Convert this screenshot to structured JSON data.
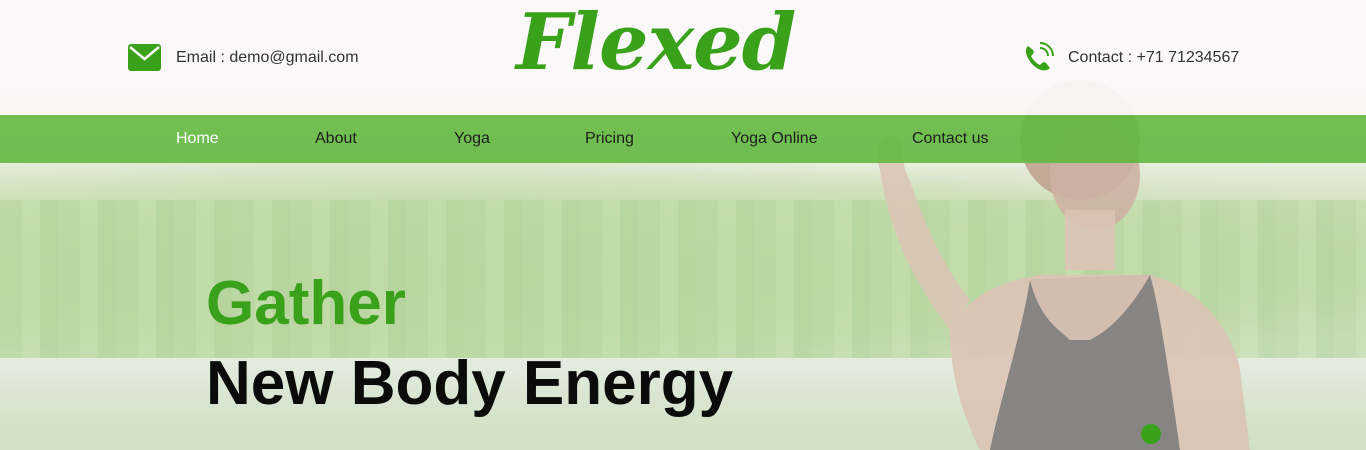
{
  "header": {
    "email_text": "Email : demo@gmail.com",
    "logo_text": "Flexed",
    "contact_text": "Contact : +71 71234567"
  },
  "nav": {
    "items": [
      {
        "label": "Home",
        "active": true
      },
      {
        "label": "About",
        "active": false
      },
      {
        "label": "Yoga",
        "active": false
      },
      {
        "label": "Pricing",
        "active": false
      },
      {
        "label": "Yoga Online",
        "active": false
      },
      {
        "label": "Contact us",
        "active": false
      }
    ]
  },
  "hero": {
    "line1": "Gather",
    "line2": "New Body Energy"
  },
  "icons": {
    "email": "envelope-icon",
    "contact": "phone-icon"
  },
  "colors": {
    "brand_green": "#3aa11a",
    "nav_green": "#63b840",
    "header_bg": "#faf8f8"
  }
}
